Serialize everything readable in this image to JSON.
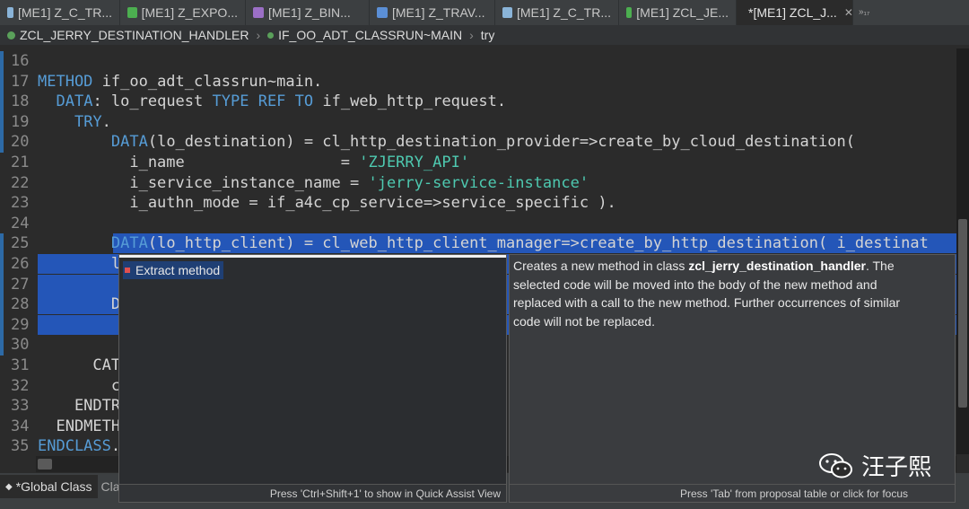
{
  "tabs": [
    {
      "label": "[ME1] Z_C_TR...",
      "color": "#8ab4d8",
      "icon": "cds-view-icon"
    },
    {
      "label": "[ME1] Z_EXPO...",
      "color": "#4caf50",
      "icon": "service-icon"
    },
    {
      "label": "[ME1] Z_BIN...",
      "color": "#9b6fc6",
      "icon": "binding-icon"
    },
    {
      "label": "[ME1] Z_TRAV...",
      "color": "#5b8fd6",
      "icon": "entity-icon"
    },
    {
      "label": "[ME1] Z_C_TR...",
      "color": "#8ab4d8",
      "icon": "projection-icon"
    },
    {
      "label": "[ME1] ZCL_JE...",
      "color": "#4caf50",
      "icon": "class-icon"
    },
    {
      "label": "*[ME1] ZCL_J...",
      "color": "#4caf50",
      "icon": "class-icon",
      "close": "✕",
      "active": true
    }
  ],
  "tab_overflow": "»₁₇",
  "breadcrumb": [
    "ZCL_JERRY_DESTINATION_HANDLER",
    "IF_OO_ADT_CLASSRUN~MAIN",
    "try"
  ],
  "code_lines": [
    {
      "n": "16",
      "text": ""
    },
    {
      "n": "17",
      "text": "METHOD if_oo_adt_classrun~main."
    },
    {
      "n": "18",
      "text": "  DATA: lo_request TYPE REF TO if_web_http_request."
    },
    {
      "n": "19",
      "text": "    TRY."
    },
    {
      "n": "20",
      "text": "        DATA(lo_destination) = cl_http_destination_provider=>create_by_cloud_destination("
    },
    {
      "n": "21",
      "text": "          i_name                 = 'ZJERRY_API'"
    },
    {
      "n": "22",
      "text": "          i_service_instance_name = 'jerry-service-instance'"
    },
    {
      "n": "23",
      "text": "          i_authn_mode = if_a4c_cp_service=>service_specific )."
    },
    {
      "n": "24",
      "text": ""
    },
    {
      "n": "25",
      "text": "        DATA(lo_http_client) = cl_web_http_client_manager=>create_by_http_destination( i_destinat"
    },
    {
      "n": "26",
      "text": "        l"
    },
    {
      "n": "27",
      "text": ""
    },
    {
      "n": "28",
      "text": "        D"
    },
    {
      "n": "29",
      "text": ""
    },
    {
      "n": "30",
      "text": ""
    },
    {
      "n": "31",
      "text": "      CAT"
    },
    {
      "n": "32",
      "text": "        c"
    },
    {
      "n": "33",
      "text": "    ENDTR"
    },
    {
      "n": "34",
      "text": "  ENDMETH"
    },
    {
      "n": "35",
      "text": "ENDCLASS."
    }
  ],
  "quick_assist": {
    "item_label": "Extract method",
    "footer": "Press 'Ctrl+Shift+1' to show in Quick Assist View"
  },
  "info_popup": {
    "text_before": "Creates a new method in class ",
    "class_name": "zcl_jerry_destination_handler",
    "text_after": ". The selected code will be moved into the body of the new method and replaced with a call to the new method. Further occurrences of similar code will not be replaced.",
    "footer": "Press 'Tab' from proposal table or click for focus"
  },
  "bottom_tabs": [
    "*Global Class",
    "Cla"
  ],
  "watermark": "汪子熙",
  "colors": {
    "selection": "#2456b8",
    "keyword": "#569cd6",
    "string": "#4ec9b0"
  }
}
